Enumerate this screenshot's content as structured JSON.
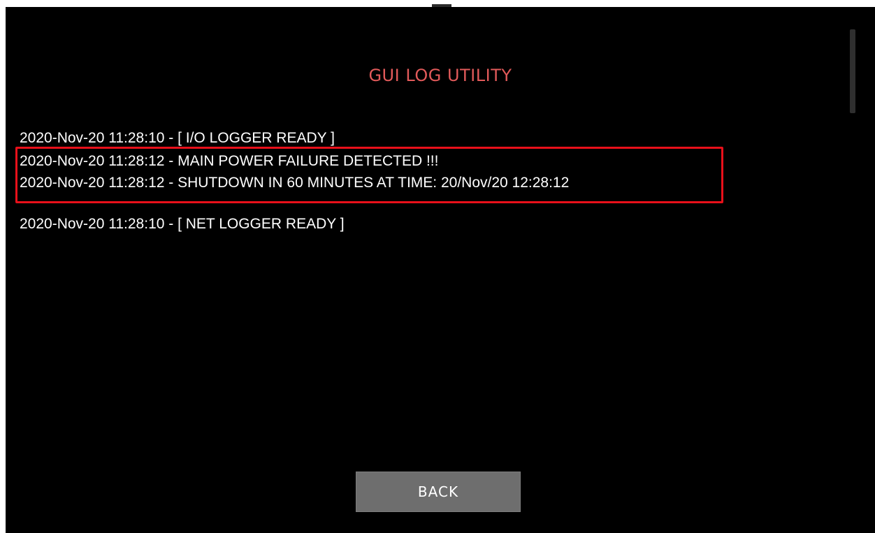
{
  "app": {
    "title": "GUI LOG UTILITY"
  },
  "log": {
    "entries": [
      "2020-Nov-20 11:28:10 - [ I/O LOGGER READY ]",
      "2020-Nov-20 11:28:12 - MAIN POWER FAILURE DETECTED !!!",
      "2020-Nov-20 11:28:12 - SHUTDOWN IN 60 MINUTES AT TIME: 20/Nov/20 12:28:12",
      "2020-Nov-20 11:28:10 - [ NET LOGGER READY ]"
    ]
  },
  "controls": {
    "back_label": "BACK"
  },
  "colors": {
    "background": "#000000",
    "title": "#e25a5a",
    "highlight": "#e8101a",
    "button": "#6e6e6e"
  }
}
